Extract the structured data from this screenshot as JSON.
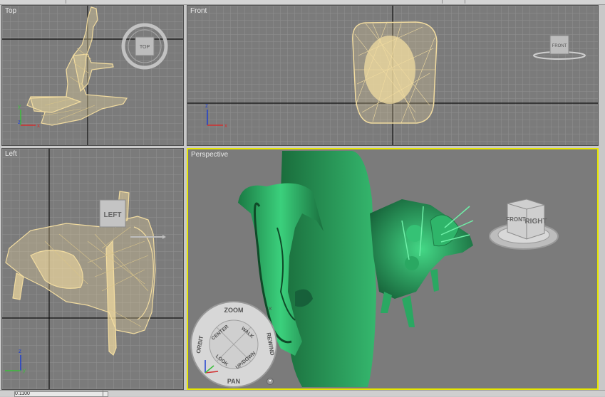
{
  "viewports": {
    "top": {
      "label": "Top",
      "cube_label": "TOP"
    },
    "front": {
      "label": "Front",
      "cube_label": "FRONT"
    },
    "left": {
      "label": "Left",
      "cube_label": "LEFT"
    },
    "perspective": {
      "label": "Perspective",
      "cube_labels": [
        "FRONT",
        "RIGHT"
      ]
    }
  },
  "axes": {
    "x": "x",
    "y": "y",
    "z": "z"
  },
  "steering_wheel": {
    "zoom": "ZOOM",
    "orbit": "ORBIT",
    "pan": "PAN",
    "rewind": "REWIND",
    "center": "CENTER",
    "walk": "WALK",
    "look": "LOOK",
    "updown": "UP/DOWN",
    "close": "×",
    "menu": "▾"
  },
  "status_bar": {
    "field_text": "0.1100"
  },
  "colors": {
    "viewport_bg": "#7b7b7b",
    "grid": "#8f8f8f",
    "grid_main": "#1a1a1a",
    "wireframe": "#f2dca0",
    "model_green": "#2ea862",
    "active_border": "#e6e600"
  }
}
